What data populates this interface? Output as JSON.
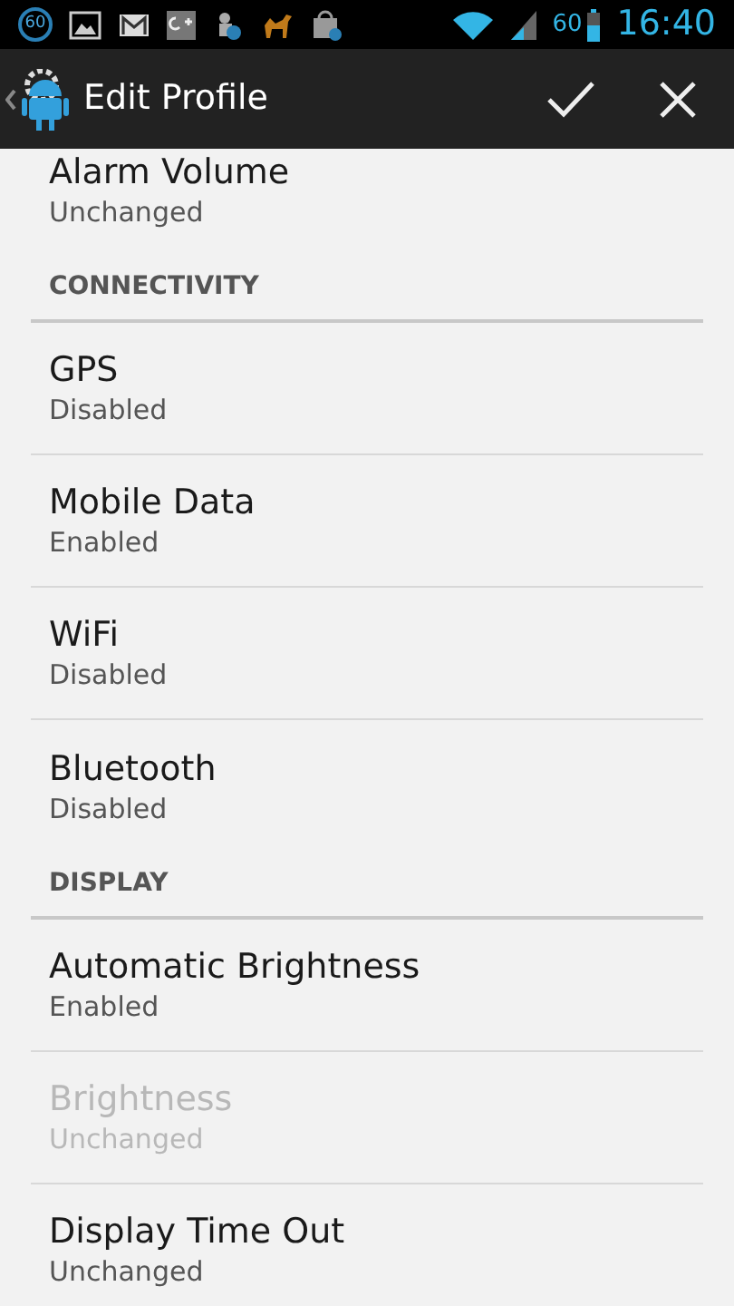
{
  "status_bar": {
    "notification_badge": "60",
    "battery_level_text": "60",
    "time": "16:40"
  },
  "action_bar": {
    "title": "Edit Profile"
  },
  "list": [
    {
      "kind": "item",
      "title": "Alarm Volume",
      "summary": "Unchanged",
      "disabled": false
    },
    {
      "kind": "header",
      "label": "CONNECTIVITY"
    },
    {
      "kind": "item",
      "title": "GPS",
      "summary": "Disabled",
      "disabled": false
    },
    {
      "kind": "item",
      "title": "Mobile Data",
      "summary": "Enabled",
      "disabled": false
    },
    {
      "kind": "item",
      "title": "WiFi",
      "summary": "Disabled",
      "disabled": false
    },
    {
      "kind": "item",
      "title": "Bluetooth",
      "summary": "Disabled",
      "disabled": false
    },
    {
      "kind": "header",
      "label": "DISPLAY"
    },
    {
      "kind": "item",
      "title": "Automatic Brightness",
      "summary": "Enabled",
      "disabled": false
    },
    {
      "kind": "item",
      "title": "Brightness",
      "summary": "Unchanged",
      "disabled": true
    },
    {
      "kind": "item",
      "title": "Display Time Out",
      "summary": "Unchanged",
      "disabled": false
    }
  ]
}
